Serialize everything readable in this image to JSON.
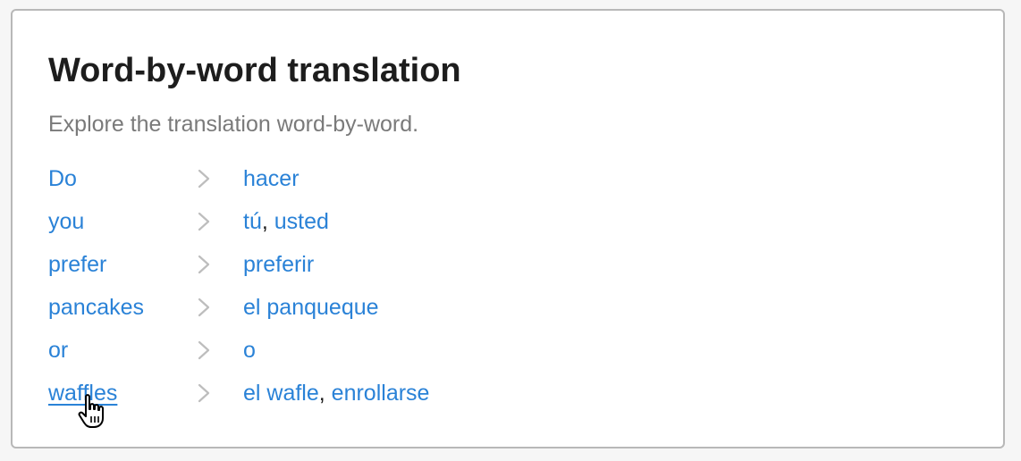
{
  "panel": {
    "title": "Word-by-word translation",
    "subtitle": "Explore the translation word-by-word."
  },
  "rows": [
    {
      "source": "Do",
      "targets": [
        "hacer"
      ]
    },
    {
      "source": "you",
      "targets": [
        "tú",
        "usted"
      ]
    },
    {
      "source": "prefer",
      "targets": [
        "preferir"
      ]
    },
    {
      "source": "pancakes",
      "targets": [
        "el panqueque"
      ]
    },
    {
      "source": "or",
      "targets": [
        "o"
      ]
    },
    {
      "source": "waffles",
      "targets": [
        "el wafle",
        "enrollarse"
      ]
    }
  ],
  "hovered_row": 5,
  "separator": ", ",
  "icons": {
    "row_arrow": "chevron-right-icon",
    "pointer": "hand-pointer-cursor-icon"
  },
  "colors": {
    "link": "#2a82d7",
    "title": "#1d1d1d",
    "subtitle": "#7a7a7a",
    "chevron": "#bdbdbd",
    "border": "#b8b8b8",
    "background": "#f6f6f6"
  }
}
